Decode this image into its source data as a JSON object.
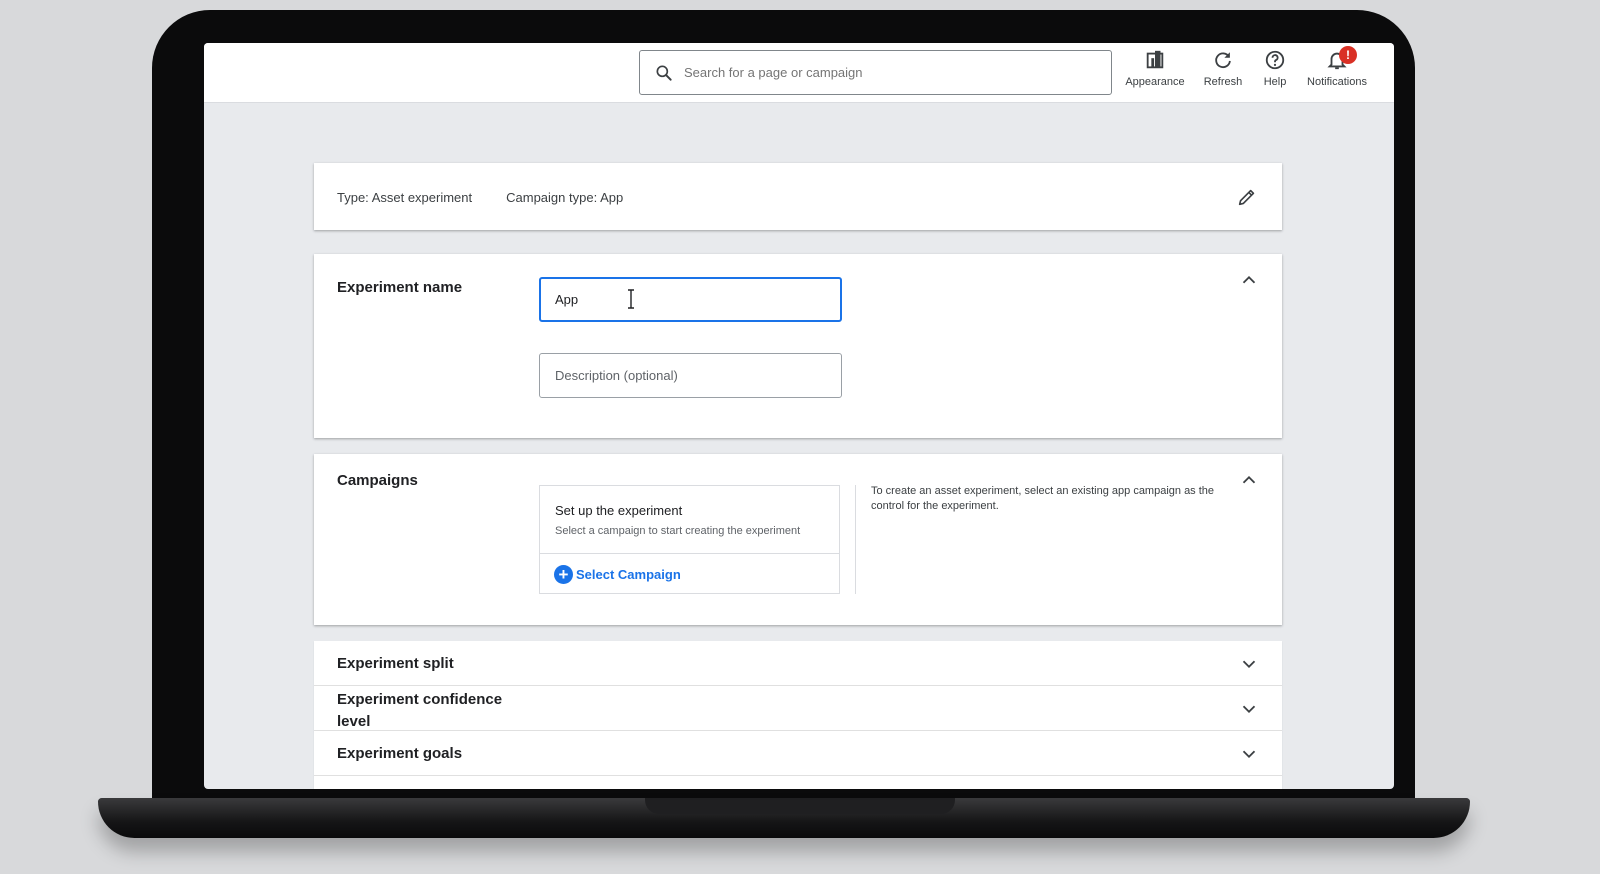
{
  "topbar": {
    "search_placeholder": "Search for a page or campaign",
    "actions": [
      {
        "label": "Appearance",
        "icon": "appearance-icon"
      },
      {
        "label": "Refresh",
        "icon": "refresh-icon"
      },
      {
        "label": "Help",
        "icon": "help-icon"
      },
      {
        "label": "Notifications",
        "icon": "bell-icon",
        "badge": "!"
      }
    ]
  },
  "summary": {
    "type_label": "Type: Asset experiment",
    "campaign_type_label": "Campaign type: App"
  },
  "experiment_name": {
    "title": "Experiment name",
    "name_value": "App",
    "description_placeholder": "Description (optional)"
  },
  "campaigns": {
    "title": "Campaigns",
    "setup_title": "Set up the experiment",
    "setup_subtitle": "Select a campaign to start creating the experiment",
    "select_button": "Select Campaign",
    "help_text": "To create an asset experiment, select an existing app campaign as the control for the experiment."
  },
  "collapsed_sections": [
    {
      "title": "Experiment split"
    },
    {
      "title": "Experiment confidence level"
    },
    {
      "title": "Experiment goals"
    }
  ],
  "colors": {
    "accent": "#1a73e8",
    "badge": "#d93025",
    "background": "#e8eaed"
  }
}
